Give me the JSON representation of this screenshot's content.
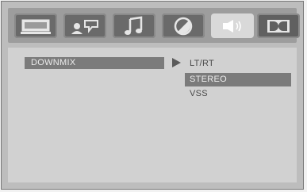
{
  "tabs": [
    {
      "icon": "tv-screen-icon"
    },
    {
      "icon": "person-speech-icon"
    },
    {
      "icon": "music-note-icon"
    },
    {
      "icon": "contrast-circle-icon"
    },
    {
      "icon": "speaker-sound-icon",
      "active": true
    },
    {
      "icon": "dolby-icon"
    }
  ],
  "menu": {
    "item_label": "DOWNMIX",
    "options": [
      "LT/RT",
      "STEREO",
      "VSS"
    ],
    "selected": "STEREO"
  }
}
